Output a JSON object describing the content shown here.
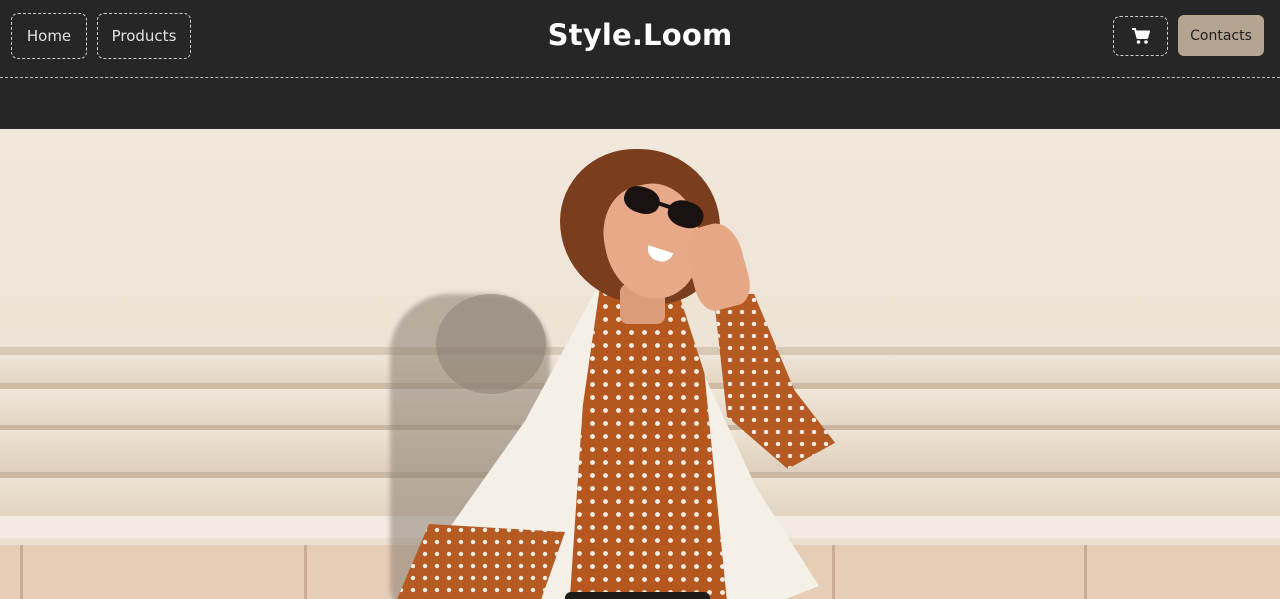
{
  "header": {
    "nav": [
      {
        "label": "Home"
      },
      {
        "label": "Products"
      }
    ],
    "brand": "Style.Loom",
    "cart_icon": "cart-icon",
    "contacts_label": "Contacts"
  },
  "colors": {
    "header_bg": "#262626",
    "text": "#ffffff",
    "accent": "#b4a590"
  },
  "hero": {
    "image": "woman-in-polka-dot-dress-photo"
  }
}
